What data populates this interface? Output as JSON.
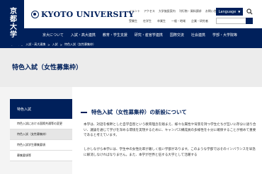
{
  "header": {
    "logo_vertical": "京都大学",
    "university_name": "KYOTO UNIVERSITY",
    "util_links": [
      "イベント",
      "アクセス",
      "大学施設案内",
      "刊行物・資料請求",
      "お問い合わせ"
    ],
    "language_label": "Language",
    "audience_links": [
      "受験生",
      "在学生",
      "卒業生",
      "一般・地域",
      "企業・研究者"
    ],
    "search_placeholder": "",
    "global_nav": [
      "京大について",
      "入試・高大連携",
      "教育・学生支援",
      "研究・産官学連携",
      "国際交流",
      "社会連携",
      "学部・大学院等"
    ]
  },
  "breadcrumb": [
    "ホーム",
    ">",
    "入試・高大連携",
    ">",
    "入試",
    ">",
    "特色入試（女性募集枠）"
  ],
  "page_title": "特色入試（女性募集枠）",
  "sidebar": {
    "heading": "特色入試",
    "items": [
      {
        "label": "特色入試における国際共通等の変更",
        "active": false
      },
      {
        "label": "特色入試（女性募集枠）",
        "active": true
      },
      {
        "label": "特色入試学生募集要項",
        "active": false
      },
      {
        "label": "募集要項等",
        "active": false
      }
    ]
  },
  "main": {
    "section_heading": "特色入試（女性募集枠）の新設について",
    "paragraph1": "本学は、対話を根幹とした自学自習という教育理念を踏まえ、様々な属性や背景を持つ学生たちが互いに存分に語り合い、議論を通じて学びを深める環境を実現するために、キャンパス構成員の多様性を十分に確保することが極めて重要であると考えています。",
    "paragraph2": "しかしながら本学には、学生中の女性比率が著しく低い学部があります。このような学部ではそのインバランスを早急に解消しなければなりません。また、本学が世界と伍する大学として活躍する"
  }
}
